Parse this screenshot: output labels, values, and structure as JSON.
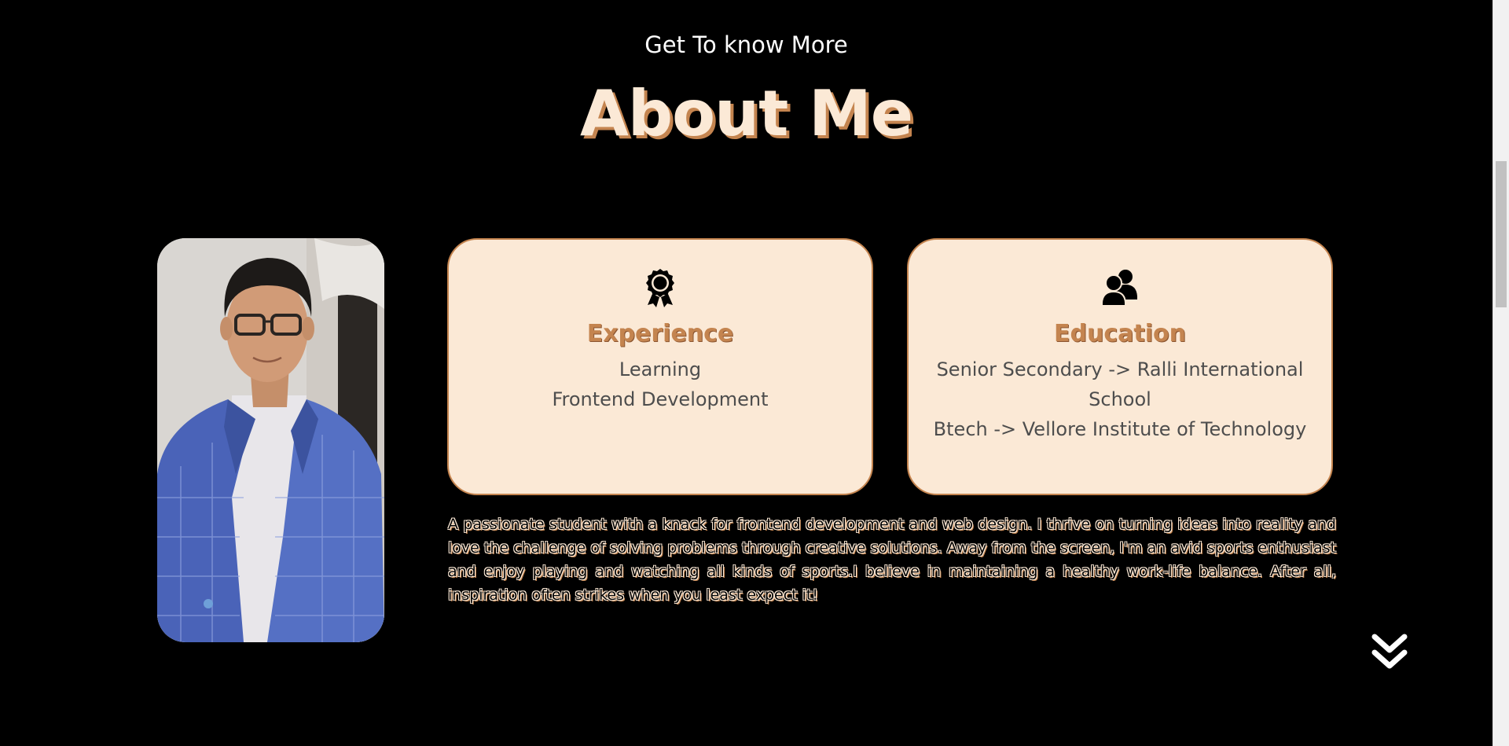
{
  "header": {
    "subtitle": "Get To know More",
    "title": "About Me"
  },
  "photo": {
    "alt": "Profile picture"
  },
  "cards": [
    {
      "icon": "award-icon",
      "title": "Experience",
      "lines": [
        "Learning",
        "Frontend Development"
      ]
    },
    {
      "icon": "users-icon",
      "title": "Education",
      "lines": [
        "Senior Secondary -> Ralli International School",
        "Btech -> Vellore Institute of Technology"
      ]
    }
  ],
  "bio": "A passionate student with a knack for frontend development and web design. I thrive on turning ideas into reality and love the challenge of solving problems through creative solutions. Away from the screen, I'm an avid sports enthusiast and enjoy playing and watching all kinds of sports.I believe in maintaining a healthy work-life balance. After all, inspiration often strikes when you least expect it!",
  "scroll_down": {
    "icon": "double-chevron-down-icon"
  },
  "colors": {
    "background": "#000000",
    "card_bg": "#fbe9d6",
    "accent": "#c4844f",
    "card_text": "#4d4d4d"
  }
}
